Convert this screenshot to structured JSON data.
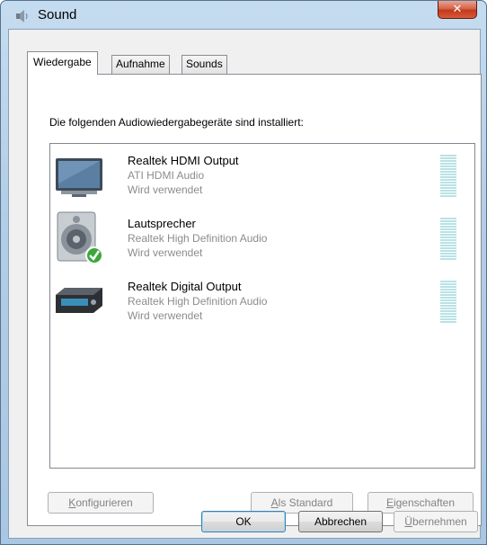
{
  "window": {
    "title": "Sound"
  },
  "tabs": [
    {
      "label": "Wiedergabe",
      "active": true
    },
    {
      "label": "Aufnahme",
      "active": false
    },
    {
      "label": "Sounds",
      "active": false
    }
  ],
  "playback": {
    "intro": "Die folgenden Audiowiedergabegeräte sind installiert:",
    "devices": [
      {
        "name": "Realtek HDMI Output",
        "driver": "ATI HDMI Audio",
        "status": "Wird verwendet",
        "icon": "monitor-icon",
        "default": false
      },
      {
        "name": "Lautsprecher",
        "driver": "Realtek High Definition Audio",
        "status": "Wird verwendet",
        "icon": "speaker-icon",
        "default": true
      },
      {
        "name": "Realtek Digital Output",
        "driver": "Realtek High Definition Audio",
        "status": "Wird verwendet",
        "icon": "digital-receiver-icon",
        "default": false
      }
    ],
    "buttons": {
      "configure_accel": "K",
      "configure_rest": "onfigurieren",
      "set_default_accel": "A",
      "set_default_rest": "ls Standard",
      "properties_accel": "E",
      "properties_rest": "igenschaften"
    }
  },
  "dialog_buttons": {
    "ok": "OK",
    "cancel": "Abbrechen",
    "apply_accel": "Ü",
    "apply_rest": "bernehmen"
  },
  "colors": {
    "meter": "#b8e2e6",
    "disabled_text": "#838383",
    "check_green": "#3aa83a",
    "close_red": "#c2391a"
  }
}
